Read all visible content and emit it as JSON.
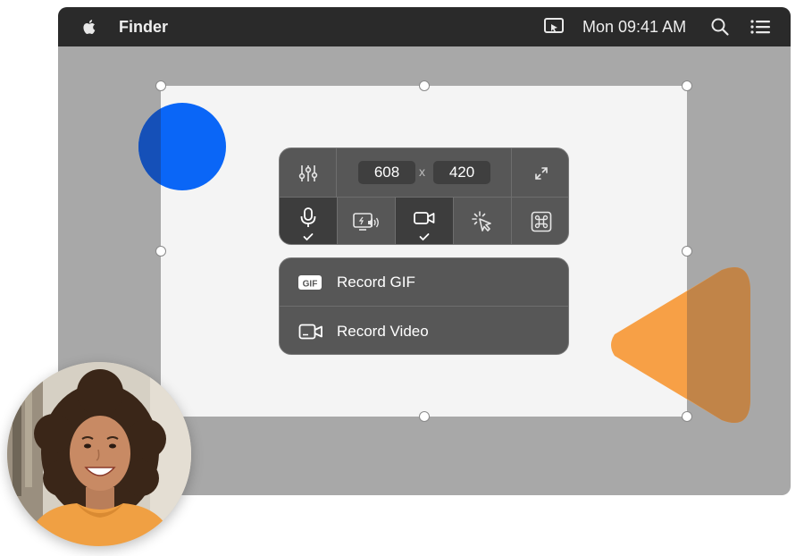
{
  "menubar": {
    "app_name": "Finder",
    "clock": "Mon 09:41 AM",
    "icons": [
      "apple-icon",
      "screen-cast-icon",
      "search-icon",
      "list-icon"
    ]
  },
  "toolbar": {
    "width_value": "608",
    "height_value": "420",
    "separator": "x",
    "options": [
      {
        "name": "microphone",
        "icon": "microphone-icon",
        "active": true,
        "checked": true
      },
      {
        "name": "system-audio",
        "icon": "system-audio-icon",
        "active": false,
        "checked": false
      },
      {
        "name": "camera",
        "icon": "camera-icon",
        "active": true,
        "checked": true
      },
      {
        "name": "click-highlight",
        "icon": "cursor-click-icon",
        "active": false,
        "checked": false
      },
      {
        "name": "keystrokes",
        "icon": "command-key-icon",
        "active": false,
        "checked": false
      }
    ]
  },
  "record_menu": {
    "gif_badge": "GIF",
    "gif_label": "Record GIF",
    "video_label": "Record Video"
  },
  "colors": {
    "menubar": "#2a2a2a",
    "screen": "#a8a8a8",
    "selection": "#f4f4f4",
    "panel": "#575757",
    "accent_blue": "#0a66f7",
    "accent_orange": "#f7a046"
  }
}
